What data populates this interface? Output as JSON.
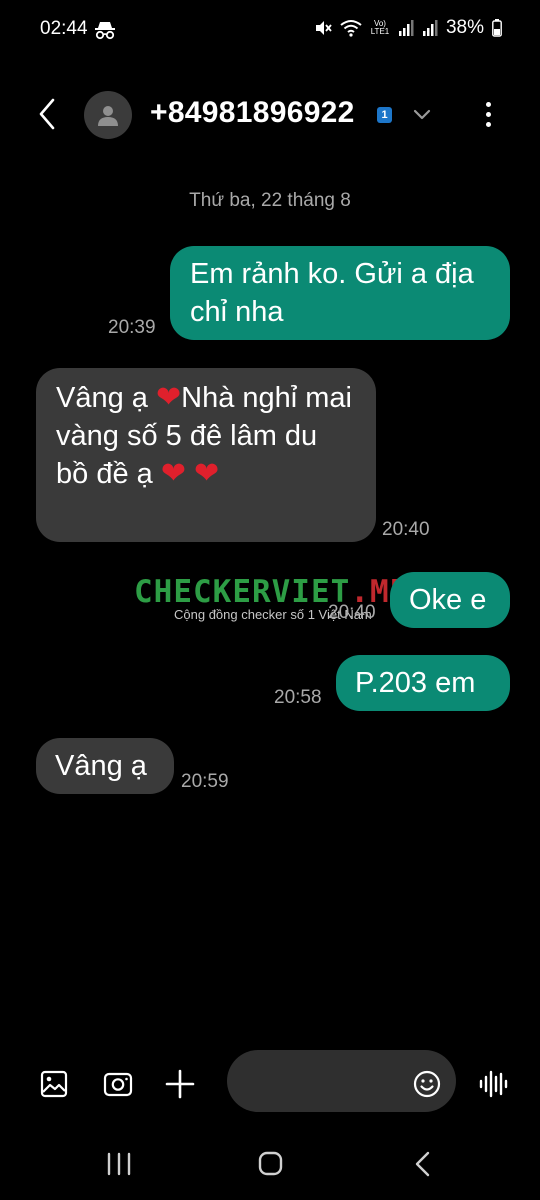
{
  "status_bar": {
    "time": "02:44",
    "battery": "38%",
    "network_label": "Vo) LTE1"
  },
  "header": {
    "contact": "+84981896922",
    "sim_badge": "1"
  },
  "date_separator": "Thứ ba, 22 tháng 8",
  "messages": [
    {
      "direction": "out",
      "text": "Em rảnh ko. Gửi a địa chỉ nha",
      "time": "20:39"
    },
    {
      "direction": "in",
      "text_parts": [
        "Vâng ạ ",
        "❤",
        "Nhà nghỉ mai vàng số 5 đê lâm du bồ đề ạ ",
        "❤",
        " ",
        "❤"
      ],
      "time": "20:40"
    },
    {
      "direction": "out",
      "text": "Oke e",
      "time": "20:40"
    },
    {
      "direction": "out",
      "text": "P.203 em",
      "time": "20:58"
    },
    {
      "direction": "in",
      "text": "Vâng ạ",
      "time": "20:59"
    }
  ],
  "watermark": {
    "main": "CHECKERVIET",
    "dot": ".",
    "suffix": "ME",
    "sub": "Cộng đồng checker số 1 Việt Nam"
  },
  "composer": {
    "placeholder": ""
  },
  "colors": {
    "outgoing_bubble": "#0b8a74",
    "incoming_bubble": "#3a3a3a",
    "heart": "#e0202c",
    "watermark_green": "#2d9d45",
    "watermark_red": "#c0282d"
  },
  "icons": [
    "incognito-icon",
    "mute-icon",
    "wifi-icon",
    "signal-icon",
    "battery-icon",
    "back-arrow-icon",
    "person-icon",
    "chevron-down-icon",
    "more-vert-icon",
    "gallery-icon",
    "camera-icon",
    "plus-icon",
    "emoji-icon",
    "voice-icon",
    "recents-icon",
    "home-icon",
    "nav-back-icon"
  ]
}
